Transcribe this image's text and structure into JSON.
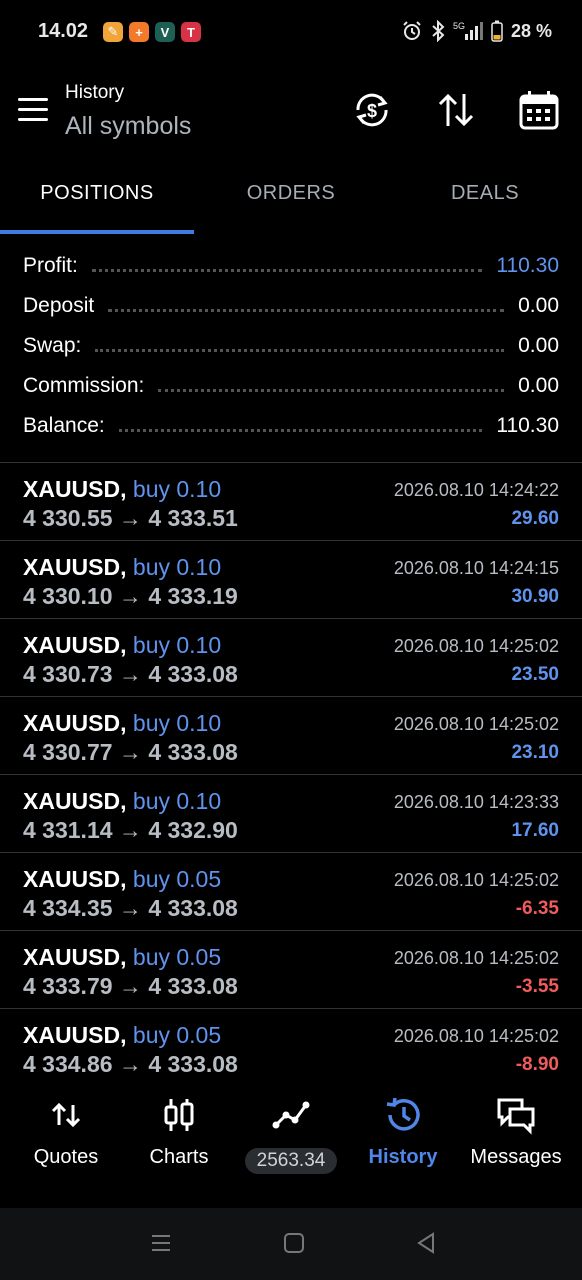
{
  "status_bar": {
    "time": "14.02",
    "battery": "28 %",
    "network": "5G"
  },
  "header": {
    "title": "History",
    "subtitle": "All symbols"
  },
  "tabs": [
    {
      "label": "POSITIONS",
      "active": true
    },
    {
      "label": "ORDERS",
      "active": false
    },
    {
      "label": "DEALS",
      "active": false
    }
  ],
  "summary": [
    {
      "label": "Profit:",
      "value": "110.30",
      "highlight": true
    },
    {
      "label": "Deposit",
      "value": "0.00",
      "highlight": false
    },
    {
      "label": "Swap:",
      "value": "0.00",
      "highlight": false
    },
    {
      "label": "Commission:",
      "value": "0.00",
      "highlight": false
    },
    {
      "label": "Balance:",
      "value": "110.30",
      "highlight": false
    }
  ],
  "positions": [
    {
      "symbol": "XAUUSD,",
      "side": "buy 0.10",
      "open": "4 330.55",
      "arrow": "→",
      "close": "4 333.51",
      "time": "2026.08.10 14:24:22",
      "profit": "29.60"
    },
    {
      "symbol": "XAUUSD,",
      "side": "buy 0.10",
      "open": "4 330.10",
      "arrow": "→",
      "close": "4 333.19",
      "time": "2026.08.10 14:24:15",
      "profit": "30.90"
    },
    {
      "symbol": "XAUUSD,",
      "side": "buy 0.10",
      "open": "4 330.73",
      "arrow": "→",
      "close": "4 333.08",
      "time": "2026.08.10 14:25:02",
      "profit": "23.50"
    },
    {
      "symbol": "XAUUSD,",
      "side": "buy 0.10",
      "open": "4 330.77",
      "arrow": "→",
      "close": "4 333.08",
      "time": "2026.08.10 14:25:02",
      "profit": "23.10"
    },
    {
      "symbol": "XAUUSD,",
      "side": "buy 0.10",
      "open": "4 331.14",
      "arrow": "→",
      "close": "4 332.90",
      "time": "2026.08.10 14:23:33",
      "profit": "17.60"
    },
    {
      "symbol": "XAUUSD,",
      "side": "buy 0.05",
      "open": "4 334.35",
      "arrow": "→",
      "close": "4 333.08",
      "time": "2026.08.10 14:25:02",
      "profit": "-6.35"
    },
    {
      "symbol": "XAUUSD,",
      "side": "buy 0.05",
      "open": "4 333.79",
      "arrow": "→",
      "close": "4 333.08",
      "time": "2026.08.10 14:25:02",
      "profit": "-3.55"
    },
    {
      "symbol": "XAUUSD,",
      "side": "buy 0.05",
      "open": "4 334.86",
      "arrow": "→",
      "close": "4 333.08",
      "time": "2026.08.10 14:25:02",
      "profit": "-8.90"
    }
  ],
  "bottom_nav": {
    "quotes": "Quotes",
    "charts": "Charts",
    "trade_badge": "2563.34",
    "history": "History",
    "messages": "Messages"
  },
  "colors": {
    "accent": "#3f7be0",
    "positive": "#5f93ee",
    "negative": "#f05b5b"
  }
}
